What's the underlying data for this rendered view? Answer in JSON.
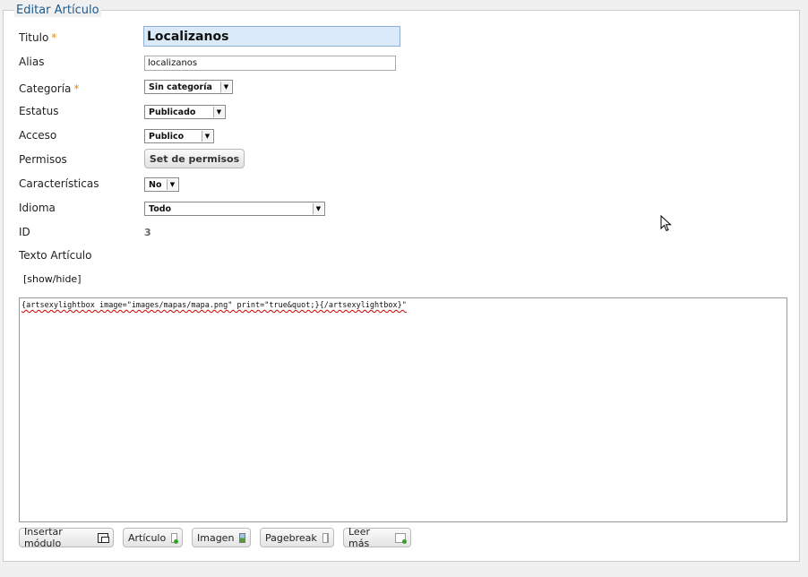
{
  "legend": "Editar Artículo",
  "required_mark": "*",
  "fields": {
    "titulo": {
      "label": "Titulo",
      "value": "Localizanos"
    },
    "alias": {
      "label": "Alias",
      "value": "localizanos"
    },
    "categoria": {
      "label": "Categoría",
      "value": "Sin categoría"
    },
    "estatus": {
      "label": "Estatus",
      "value": "Publicado"
    },
    "acceso": {
      "label": "Acceso",
      "value": "Publico"
    },
    "permisos": {
      "label": "Permisos",
      "button": "Set de permisos"
    },
    "caracteristicas": {
      "label": "Características",
      "value": "No"
    },
    "idioma": {
      "label": "Idioma",
      "value": "Todo"
    },
    "id": {
      "label": "ID",
      "value": "3"
    },
    "texto": {
      "label": "Texto Artículo"
    }
  },
  "editor": {
    "toggle": "[show/hide]",
    "content": "{artsexylightbox image=\"images/mapas/mapa.png\" print=\"true&quot;}{/artsexylightbox}\""
  },
  "editor_buttons": [
    {
      "label": "Insertar módulo",
      "icon": "module-icon"
    },
    {
      "label": "Artículo",
      "icon": "article-icon"
    },
    {
      "label": "Imagen",
      "icon": "image-icon"
    },
    {
      "label": "Pagebreak",
      "icon": "pagebreak-icon"
    },
    {
      "label": "Leer más",
      "icon": "readmore-icon"
    }
  ]
}
